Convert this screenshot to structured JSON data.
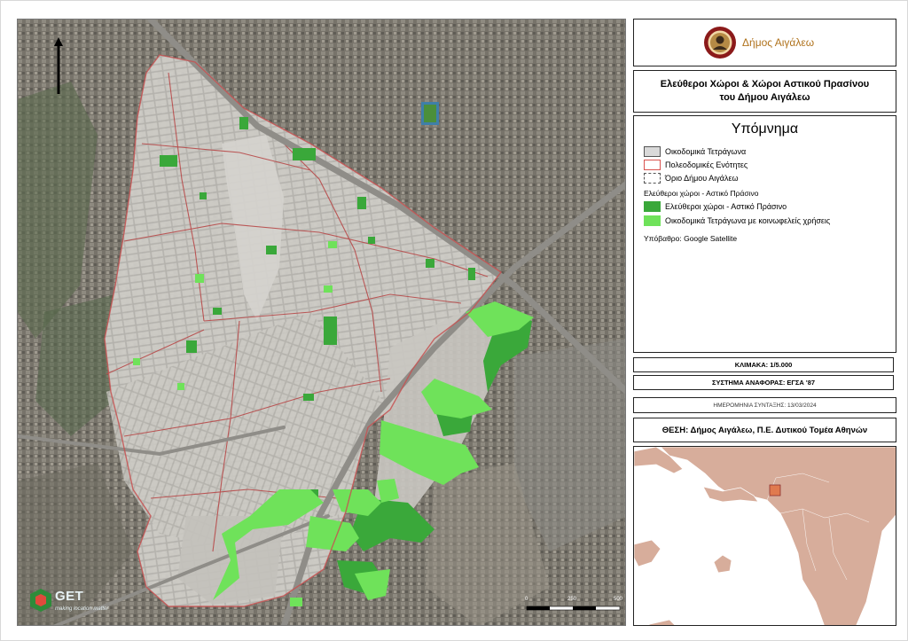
{
  "header": {
    "municipality": "Δήμος Αιγάλεω"
  },
  "title": {
    "line1": "Ελεύθεροι Χώροι & Χώροι Αστικού Πρασίνου",
    "line2": "του Δήμου Αιγάλεω"
  },
  "legend": {
    "title": "Υπόμνημα",
    "items": [
      {
        "label": "Οικοδομικά Τετράγωνα",
        "color": "#d9d9d9"
      },
      {
        "label": "Πολεοδομικές Ενότητες",
        "color": "#d9534f"
      },
      {
        "label": "Όριο Δήμου Αιγάλεω",
        "color": "#555555"
      }
    ],
    "group_title": "Ελεύθεροι χώροι - Αστικό Πράσινο",
    "green_items": [
      {
        "label": "Ελεύθεροι χώροι - Αστικό Πράσινο",
        "color": "#3aa83a"
      },
      {
        "label": "Οικοδομικά Τετράγωνα με κοινωφελείς χρήσεις",
        "color": "#6fe25a"
      }
    ],
    "basemap": "Υπόβαθρο: Google Satellite"
  },
  "scale_text": "ΚΛΙΜΑΚΑ: 1/5.000",
  "crs_text": "ΣΥΣΤΗΜΑ ΑΝΑΦΟΡΑΣ: ΕΓΣΑ '87",
  "date_text": "ΗΜΕΡΟΜΗΝΙΑ ΣΥΝΤΑΞΗΣ: 13/03/2024",
  "position_text": "ΘΕΣΗ: Δήμος Αιγάλεω, Π.Ε. Δυτικού Τομέα Αθηνών",
  "scalebar": {
    "labels": [
      "0",
      "250",
      "500"
    ]
  },
  "branding": {
    "name": "GET",
    "tagline": "making location matter"
  },
  "colors": {
    "green_space": "#3aa83a",
    "public_blocks": "#6fe25a",
    "district_line": "#b84a4a",
    "inset_land": "#d7ad9b",
    "inset_highlight": "#e07a4f"
  }
}
